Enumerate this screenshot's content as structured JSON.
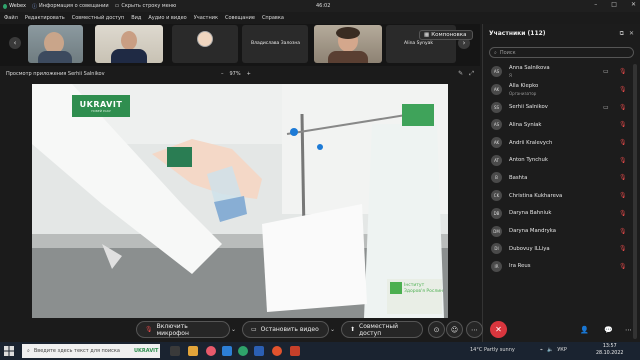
{
  "titlebar": {
    "app_name": "Webex",
    "meeting_info": "Информация о совещании",
    "hide_menu": "Скрыть строку меню",
    "time": "46:02"
  },
  "menu": [
    "Файл",
    "Редактировать",
    "Совместный доступ",
    "Вид",
    "Аудио и видео",
    "Участник",
    "Совещание",
    "Справка"
  ],
  "strip": {
    "tile3_name": "Владислава Залозна",
    "tile4_name": "Alina Synyak",
    "layout_button": "Компоновка"
  },
  "viewer": {
    "title": "Просмотр приложения Serhii Salnikov",
    "zoom_out": "–",
    "zoom_value": "97%",
    "zoom_in": "+"
  },
  "share": {
    "logo_main": "UKRAVIT",
    "logo_sub": "ПОБЕЙ РАКУ",
    "institute": "Інститут Здоров'я Рослин"
  },
  "panel": {
    "title": "Участники (112)",
    "search_placeholder": "Поиск",
    "participants": [
      {
        "initials": "AS",
        "name": "Anna Salnikova",
        "role": "Я",
        "camera": true
      },
      {
        "initials": "AK",
        "name": "Alla Klepko",
        "role": "Организатор",
        "camera": false
      },
      {
        "initials": "SS",
        "name": "Serhii Salnikov",
        "role": "",
        "camera": true
      },
      {
        "initials": "AS",
        "name": "Alina Syniak",
        "role": "",
        "camera": false
      },
      {
        "initials": "AK",
        "name": "Andrii Kralevych",
        "role": "",
        "camera": false
      },
      {
        "initials": "AT",
        "name": "Anton Tynchuk",
        "role": "",
        "camera": false
      },
      {
        "initials": "B",
        "name": "Bashta",
        "role": "",
        "camera": false
      },
      {
        "initials": "CK",
        "name": "Christina Kukhareva",
        "role": "",
        "camera": false
      },
      {
        "initials": "DB",
        "name": "Daryna Bahniuk",
        "role": "",
        "camera": false
      },
      {
        "initials": "DM",
        "name": "Daryna Mandryka",
        "role": "",
        "camera": false
      },
      {
        "initials": "DI",
        "name": "Dubovuy ILLiya",
        "role": "",
        "camera": false
      },
      {
        "initials": "IR",
        "name": "Ira Reus",
        "role": "",
        "camera": false
      }
    ]
  },
  "controls": {
    "mic": "Включить микрофон",
    "video": "Остановить видео",
    "share": "Совместный доступ"
  },
  "taskbar": {
    "search": "Введите здесь текст для поиска",
    "app_label": "UKRAVIT",
    "weather": "14°C  Partly sunny",
    "lang": "УКР",
    "time": "13:57",
    "date": "28.10.2022"
  }
}
